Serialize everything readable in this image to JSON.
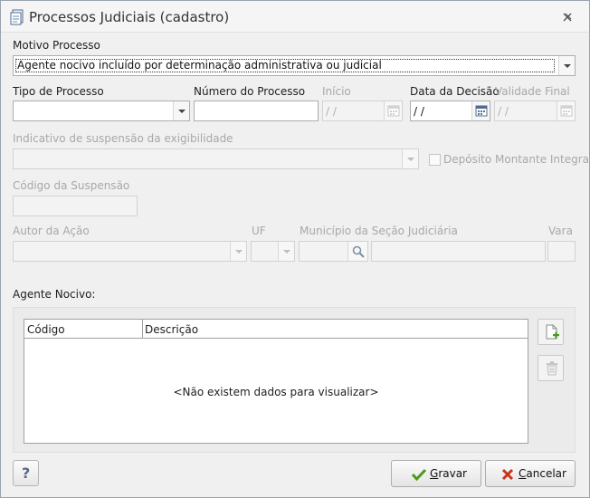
{
  "window": {
    "title": "Processos Judiciais (cadastro)"
  },
  "motivo": {
    "label": "Motivo Processo",
    "value": "Agente nocivo incluído por determinação administrativa ou judicial"
  },
  "tipo": {
    "label": "Tipo de Processo",
    "value": ""
  },
  "numero": {
    "label": "Número do Processo",
    "value": ""
  },
  "inicio": {
    "label": "Início",
    "value": " /  /"
  },
  "data_decisao": {
    "label": "Data da Decisão",
    "value": " / /"
  },
  "validade_final": {
    "label": "Validade Final",
    "value": " /  /"
  },
  "indicativo": {
    "label": "Indicativo de suspensão da exigibilidade",
    "value": ""
  },
  "deposito": {
    "label": "Depósito Montante Integral",
    "checked": false
  },
  "codigo_suspensao": {
    "label": "Código da Suspensão",
    "value": ""
  },
  "autor": {
    "label": "Autor da Ação",
    "value": ""
  },
  "uf": {
    "label": "UF",
    "value": ""
  },
  "municipio": {
    "label": "Município da Seção Judiciária",
    "value": ""
  },
  "vara": {
    "label": "Vara",
    "value": ""
  },
  "agente": {
    "label": "Agente Nocivo:",
    "columns": [
      "Código",
      "Descrição"
    ],
    "empty_message": "<Não existem dados para visualizar>"
  },
  "buttons": {
    "help": "?",
    "gravar_accel": "G",
    "gravar_rest": "ravar",
    "cancelar_accel": "C",
    "cancelar_rest": "ancelar"
  },
  "icons": {
    "title": "document-icon",
    "close": "close-icon",
    "calendar": "calendar-icon",
    "search": "search-icon",
    "add": "add-document-icon",
    "delete": "trash-icon",
    "save": "check-icon",
    "cancel": "x-icon",
    "help": "help-icon"
  },
  "colors": {
    "accent_green": "#4a9a1e",
    "cancel_red": "#c8341b",
    "disabled_text": "#a8a8a8"
  }
}
